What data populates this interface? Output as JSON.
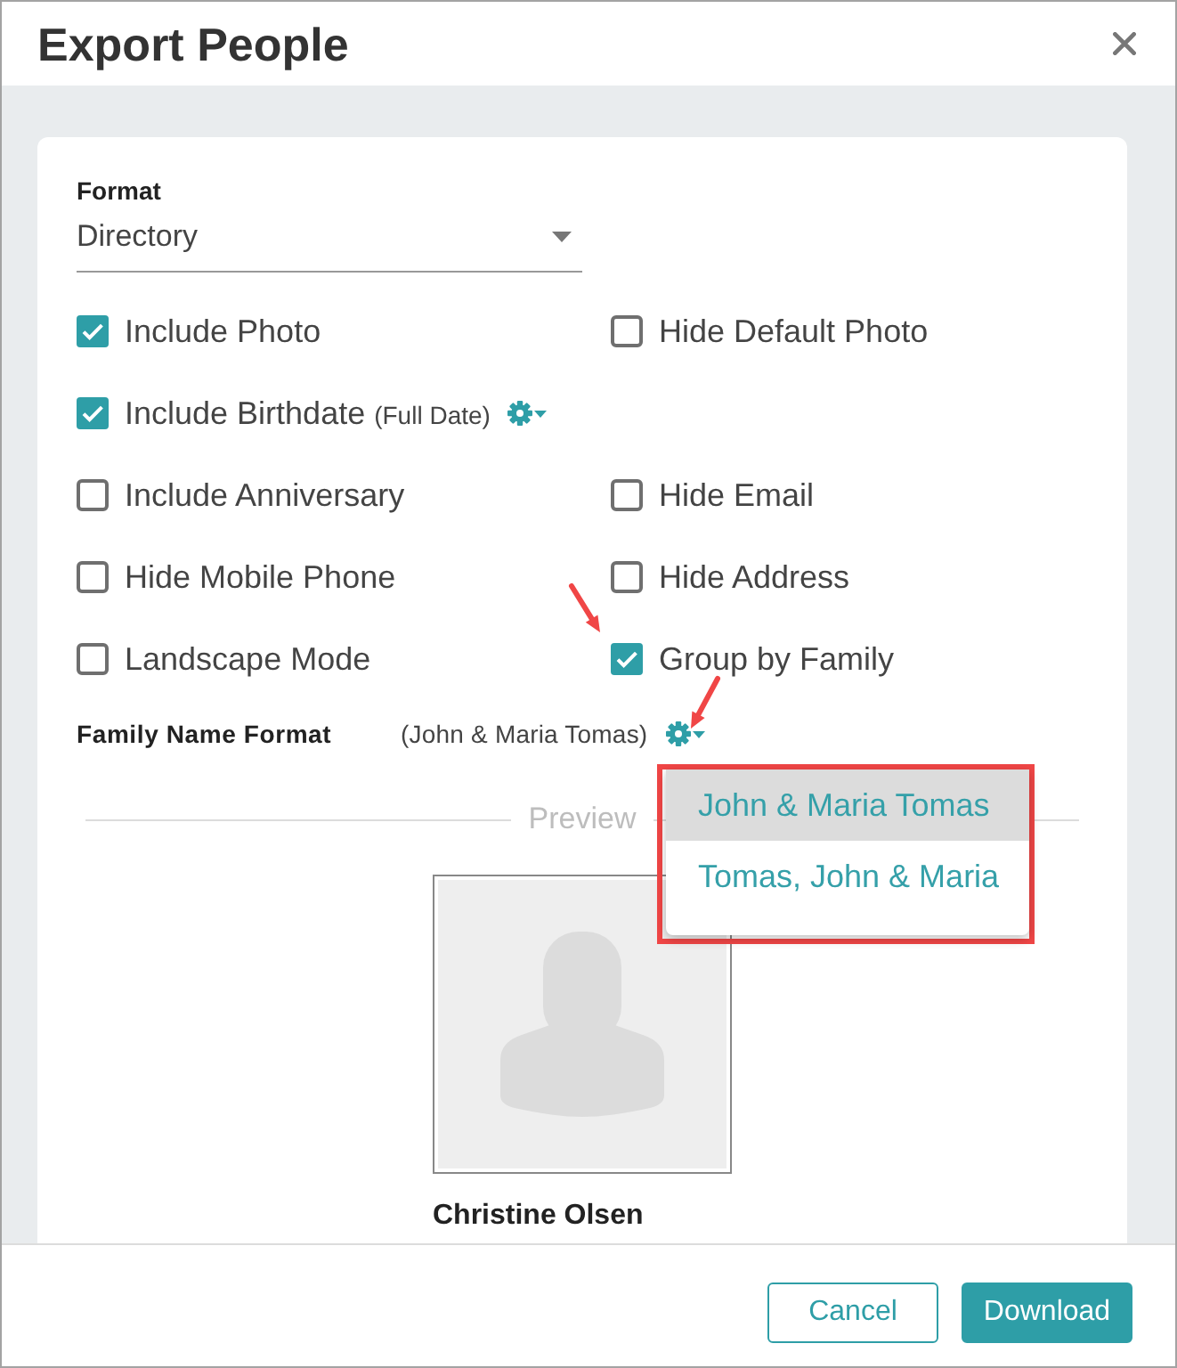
{
  "window": {
    "title": "Export People"
  },
  "format": {
    "label": "Format",
    "value": "Directory"
  },
  "option_rows": [
    [
      {
        "label": "Include Photo",
        "checked": true
      },
      {
        "label": "Hide Default Photo",
        "checked": false
      }
    ],
    [
      {
        "label": "Include Birthdate",
        "note": "(Full Date)",
        "settings": true,
        "checked": true
      }
    ],
    [
      {
        "label": "Include Anniversary",
        "checked": false
      },
      {
        "label": "Hide Email",
        "checked": false
      }
    ],
    [
      {
        "label": "Hide Mobile Phone",
        "checked": false
      },
      {
        "label": "Hide Address",
        "checked": false
      }
    ],
    [
      {
        "label": "Landscape Mode",
        "checked": false
      },
      {
        "label": "Group by Family",
        "checked": true
      }
    ]
  ],
  "family_name_format": {
    "label": "Family Name Format",
    "value": "(John & Maria Tomas)",
    "menu_open": true,
    "menu": [
      {
        "label": "John & Maria Tomas",
        "selected": true
      },
      {
        "label": "Tomas, John & Maria",
        "selected": false
      }
    ]
  },
  "preview": {
    "heading": "Preview",
    "name": "Christine Olsen"
  },
  "buttons": [
    {
      "label": "Cancel",
      "kind": "secondary"
    },
    {
      "label": "Download",
      "kind": "primary"
    }
  ]
}
